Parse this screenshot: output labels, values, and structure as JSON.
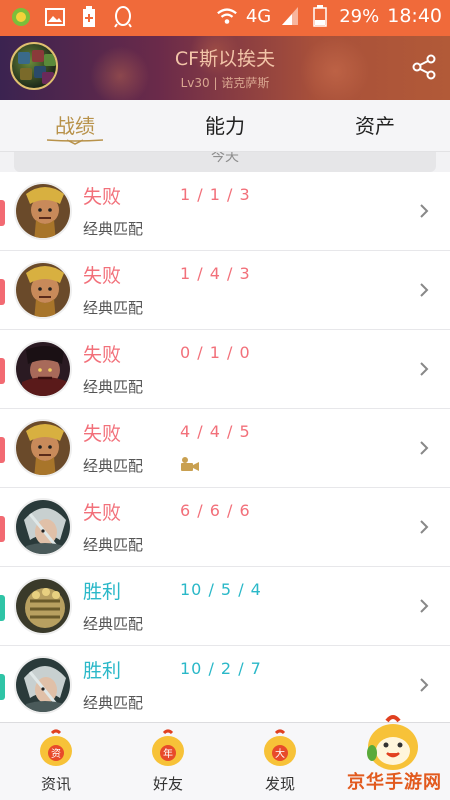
{
  "status_bar": {
    "network": "4G",
    "battery": "29%",
    "time": "18:40",
    "icons": [
      "app-icon",
      "gallery-icon",
      "battery-plus-icon",
      "qq-icon",
      "wifi-icon",
      "signal-icon",
      "battery-icon"
    ]
  },
  "profile": {
    "name": "CF斯以挨夫",
    "subtitle": "Lv30 | 诺克萨斯",
    "share_icon": "share-icon"
  },
  "tabs": [
    {
      "label": "战绩",
      "active": true
    },
    {
      "label": "能力",
      "active": false
    },
    {
      "label": "资产",
      "active": false
    }
  ],
  "date_separator": "今天",
  "colors": {
    "loss": "#f2707a",
    "win": "#2ab8c8",
    "loss_indicator": "#f26a72",
    "win_indicator": "#2fc4a6",
    "accent_gold": "#b8924a"
  },
  "matches": [
    {
      "result": "失败",
      "win": false,
      "kda": "1 / 1 / 3",
      "mode": "经典匹配",
      "video": false,
      "hero": "gold-warrior"
    },
    {
      "result": "失败",
      "win": false,
      "kda": "1 / 4 / 3",
      "mode": "经典匹配",
      "video": false,
      "hero": "gold-warrior"
    },
    {
      "result": "失败",
      "win": false,
      "kda": "0 / 1 / 0",
      "mode": "经典匹配",
      "video": false,
      "hero": "dark-warrior"
    },
    {
      "result": "失败",
      "win": false,
      "kda": "4 / 4 / 5",
      "mode": "经典匹配",
      "video": true,
      "hero": "gold-warrior"
    },
    {
      "result": "失败",
      "win": false,
      "kda": "6 / 6 / 6",
      "mode": "经典匹配",
      "video": false,
      "hero": "silver-hair"
    },
    {
      "result": "胜利",
      "win": true,
      "kda": "10 / 5 / 4",
      "mode": "经典匹配",
      "video": false,
      "hero": "gauntlet"
    },
    {
      "result": "胜利",
      "win": true,
      "kda": "10 / 2 / 7",
      "mode": "经典匹配",
      "video": false,
      "hero": "silver-hair"
    }
  ],
  "bottom_nav": [
    {
      "label": "资讯",
      "badge": "资"
    },
    {
      "label": "好友",
      "badge": "年"
    },
    {
      "label": "发现",
      "badge": "大"
    },
    {
      "label": "",
      "badge": ""
    }
  ],
  "watermark": "京华手游网"
}
